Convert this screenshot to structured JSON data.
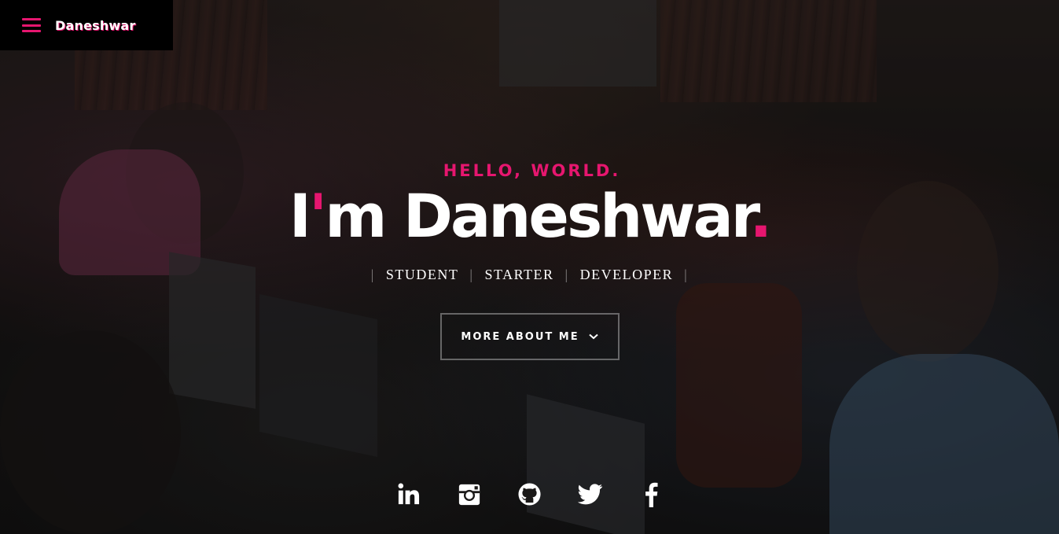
{
  "nav": {
    "menu_icon": "hamburger-menu-icon",
    "brand": "Daneshwar"
  },
  "hero": {
    "greeting": "HELLO, WORLD.",
    "headline_prefix": "I",
    "headline_apostrophe": "'",
    "headline_rest": "m Daneshwar",
    "headline_dot": ".",
    "roles": [
      "STUDENT",
      "STARTER",
      "DEVELOPER"
    ],
    "role_separator": "|",
    "more_button": "MORE ABOUT ME",
    "more_button_icon": "chevron-down-icon"
  },
  "social": [
    {
      "name": "linkedin",
      "icon": "linkedin-icon"
    },
    {
      "name": "instagram",
      "icon": "instagram-icon"
    },
    {
      "name": "github",
      "icon": "github-icon"
    },
    {
      "name": "twitter",
      "icon": "twitter-icon"
    },
    {
      "name": "facebook",
      "icon": "facebook-icon"
    }
  ],
  "colors": {
    "accent": "#e6166f",
    "text": "#ffffff",
    "nav_bg": "#000000"
  }
}
